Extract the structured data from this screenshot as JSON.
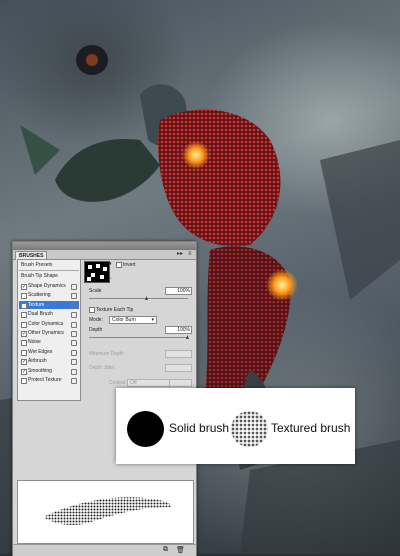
{
  "panel": {
    "tab_label": "BRUSHES",
    "collapse_glyph": "▸▸",
    "menu_glyph": "≡",
    "brush_presets_label": "Brush Presets",
    "brush_tip_shape_label": "Brush Tip Shape",
    "options": [
      {
        "label": "Shape Dynamics",
        "checked": true,
        "selected": false
      },
      {
        "label": "Scattering",
        "checked": false,
        "selected": false
      },
      {
        "label": "Texture",
        "checked": true,
        "selected": true
      },
      {
        "label": "Dual Brush",
        "checked": false,
        "selected": false
      },
      {
        "label": "Color Dynamics",
        "checked": false,
        "selected": false
      },
      {
        "label": "Other Dynamics",
        "checked": true,
        "selected": false
      },
      {
        "label": "Noise",
        "checked": false,
        "selected": false
      },
      {
        "label": "Wet Edges",
        "checked": false,
        "selected": false
      },
      {
        "label": "Airbrush",
        "checked": true,
        "selected": false
      },
      {
        "label": "Smoothing",
        "checked": true,
        "selected": false
      },
      {
        "label": "Protect Texture",
        "checked": false,
        "selected": false
      }
    ],
    "texture": {
      "invert_label": "Invert",
      "scale_label": "Scale",
      "scale_value": "100%",
      "texture_each_tip_label": "Texture Each Tip",
      "mode_label": "Mode:",
      "mode_value": "Color Burn",
      "depth_label": "Depth",
      "depth_value": "100%",
      "minimum_depth_label": "Minimum Depth",
      "depth_jitter_label": "Depth Jitter",
      "control_label": "Control:",
      "control_value": "Off"
    }
  },
  "legend": {
    "solid_label": "Solid brush",
    "textured_label": "Textured brush"
  },
  "colors": {
    "selection": "#3b79d6",
    "texture_red": "#c8141a",
    "glow_orange": "#ff9a1a"
  }
}
